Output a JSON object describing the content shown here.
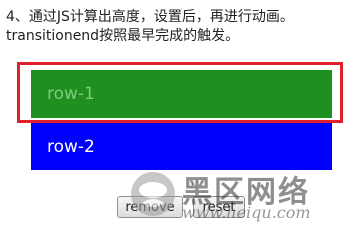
{
  "instruction": {
    "line1": "4、通过JS计算出高度，设置后，再进行动画。",
    "line2": "transitionend按照最早完成的触发。"
  },
  "rows": [
    {
      "label": "row-1"
    },
    {
      "label": "row-2"
    }
  ],
  "buttons": {
    "remove": "remove",
    "reset": "reset"
  },
  "watermark": {
    "title": "黑区网络",
    "url": "www.heiqu.com"
  },
  "colors": {
    "row1_bg": "#1f8f1f",
    "row1_text": "#7ecb7e",
    "row2_bg": "#0000ff",
    "row2_text": "#ffffff",
    "highlight": "#e0202a"
  }
}
